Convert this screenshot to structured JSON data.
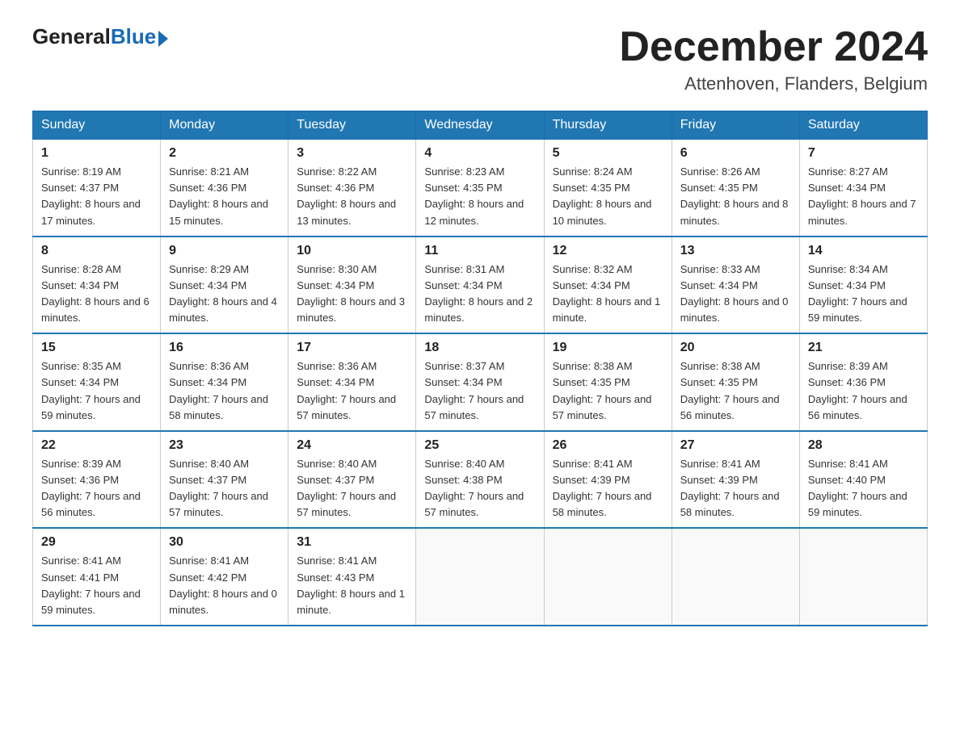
{
  "logo": {
    "general": "General",
    "blue": "Blue"
  },
  "title": "December 2024",
  "location": "Attenhoven, Flanders, Belgium",
  "weekdays": [
    "Sunday",
    "Monday",
    "Tuesday",
    "Wednesday",
    "Thursday",
    "Friday",
    "Saturday"
  ],
  "weeks": [
    [
      {
        "day": "1",
        "sunrise": "8:19 AM",
        "sunset": "4:37 PM",
        "daylight": "8 hours and 17 minutes."
      },
      {
        "day": "2",
        "sunrise": "8:21 AM",
        "sunset": "4:36 PM",
        "daylight": "8 hours and 15 minutes."
      },
      {
        "day": "3",
        "sunrise": "8:22 AM",
        "sunset": "4:36 PM",
        "daylight": "8 hours and 13 minutes."
      },
      {
        "day": "4",
        "sunrise": "8:23 AM",
        "sunset": "4:35 PM",
        "daylight": "8 hours and 12 minutes."
      },
      {
        "day": "5",
        "sunrise": "8:24 AM",
        "sunset": "4:35 PM",
        "daylight": "8 hours and 10 minutes."
      },
      {
        "day": "6",
        "sunrise": "8:26 AM",
        "sunset": "4:35 PM",
        "daylight": "8 hours and 8 minutes."
      },
      {
        "day": "7",
        "sunrise": "8:27 AM",
        "sunset": "4:34 PM",
        "daylight": "8 hours and 7 minutes."
      }
    ],
    [
      {
        "day": "8",
        "sunrise": "8:28 AM",
        "sunset": "4:34 PM",
        "daylight": "8 hours and 6 minutes."
      },
      {
        "day": "9",
        "sunrise": "8:29 AM",
        "sunset": "4:34 PM",
        "daylight": "8 hours and 4 minutes."
      },
      {
        "day": "10",
        "sunrise": "8:30 AM",
        "sunset": "4:34 PM",
        "daylight": "8 hours and 3 minutes."
      },
      {
        "day": "11",
        "sunrise": "8:31 AM",
        "sunset": "4:34 PM",
        "daylight": "8 hours and 2 minutes."
      },
      {
        "day": "12",
        "sunrise": "8:32 AM",
        "sunset": "4:34 PM",
        "daylight": "8 hours and 1 minute."
      },
      {
        "day": "13",
        "sunrise": "8:33 AM",
        "sunset": "4:34 PM",
        "daylight": "8 hours and 0 minutes."
      },
      {
        "day": "14",
        "sunrise": "8:34 AM",
        "sunset": "4:34 PM",
        "daylight": "7 hours and 59 minutes."
      }
    ],
    [
      {
        "day": "15",
        "sunrise": "8:35 AM",
        "sunset": "4:34 PM",
        "daylight": "7 hours and 59 minutes."
      },
      {
        "day": "16",
        "sunrise": "8:36 AM",
        "sunset": "4:34 PM",
        "daylight": "7 hours and 58 minutes."
      },
      {
        "day": "17",
        "sunrise": "8:36 AM",
        "sunset": "4:34 PM",
        "daylight": "7 hours and 57 minutes."
      },
      {
        "day": "18",
        "sunrise": "8:37 AM",
        "sunset": "4:34 PM",
        "daylight": "7 hours and 57 minutes."
      },
      {
        "day": "19",
        "sunrise": "8:38 AM",
        "sunset": "4:35 PM",
        "daylight": "7 hours and 57 minutes."
      },
      {
        "day": "20",
        "sunrise": "8:38 AM",
        "sunset": "4:35 PM",
        "daylight": "7 hours and 56 minutes."
      },
      {
        "day": "21",
        "sunrise": "8:39 AM",
        "sunset": "4:36 PM",
        "daylight": "7 hours and 56 minutes."
      }
    ],
    [
      {
        "day": "22",
        "sunrise": "8:39 AM",
        "sunset": "4:36 PM",
        "daylight": "7 hours and 56 minutes."
      },
      {
        "day": "23",
        "sunrise": "8:40 AM",
        "sunset": "4:37 PM",
        "daylight": "7 hours and 57 minutes."
      },
      {
        "day": "24",
        "sunrise": "8:40 AM",
        "sunset": "4:37 PM",
        "daylight": "7 hours and 57 minutes."
      },
      {
        "day": "25",
        "sunrise": "8:40 AM",
        "sunset": "4:38 PM",
        "daylight": "7 hours and 57 minutes."
      },
      {
        "day": "26",
        "sunrise": "8:41 AM",
        "sunset": "4:39 PM",
        "daylight": "7 hours and 58 minutes."
      },
      {
        "day": "27",
        "sunrise": "8:41 AM",
        "sunset": "4:39 PM",
        "daylight": "7 hours and 58 minutes."
      },
      {
        "day": "28",
        "sunrise": "8:41 AM",
        "sunset": "4:40 PM",
        "daylight": "7 hours and 59 minutes."
      }
    ],
    [
      {
        "day": "29",
        "sunrise": "8:41 AM",
        "sunset": "4:41 PM",
        "daylight": "7 hours and 59 minutes."
      },
      {
        "day": "30",
        "sunrise": "8:41 AM",
        "sunset": "4:42 PM",
        "daylight": "8 hours and 0 minutes."
      },
      {
        "day": "31",
        "sunrise": "8:41 AM",
        "sunset": "4:43 PM",
        "daylight": "8 hours and 1 minute."
      },
      null,
      null,
      null,
      null
    ]
  ],
  "labels": {
    "sunrise": "Sunrise:",
    "sunset": "Sunset:",
    "daylight": "Daylight:"
  }
}
